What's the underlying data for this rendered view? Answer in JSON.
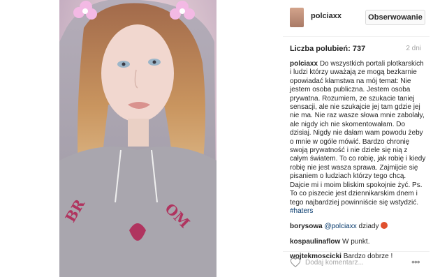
{
  "post": {
    "username": "polciaxx",
    "follow_label": "Obserwowanie",
    "likes_label": "Liczba polubień:",
    "likes_count": "737",
    "time_ago": "2 dni",
    "caption_user": "polciaxx",
    "caption_text": "Do wszystkich portali plotkarskich i ludzi którzy uważają ze mogą bezkarnie opowiadać kłamstwa na mój temat: Nie jestem osoba publiczna. Jestem osoba prywatna. Rozumiem, ze szukacie taniej sensacji, ale nie szukajcie jej tam gdzie jej nie ma. Nie raz wasze słowa mnie zabolały, ale nigdy ich nie skomentowałam. Do dzisiaj. Nigdy nie dałam wam powodu żeby o mnie w ogóle mówić. Bardzo chronię swoją prywatność i nie dziele się nią z całym światem. To co robię, jak robię i kiedy robię nie jest wasza sprawa. Zajmijcie się pisaniem o ludziach którzy tego chcą. Dajcie mi i moim bliskim spokojnie żyć. Ps. To co piszecie jest dziennikarskim dnem i tego najbardziej powinniście się wstydzić.",
    "caption_hashtag": "#haters"
  },
  "comments": [
    {
      "user": "borysowa",
      "mention": "@polciaxx",
      "text": "dziady",
      "emoji": "angry-face-emoji"
    },
    {
      "user": "kospaulinaflow",
      "text": "W punkt."
    },
    {
      "user": "wojtekmoscicki",
      "text": "Bardzo dobrze !"
    }
  ],
  "add_comment": {
    "placeholder": "Dodaj komentarz...",
    "like_icon": "heart-outline-icon",
    "more_icon": "more-options-icon"
  },
  "colors": {
    "link": "#003569",
    "muted": "#a6a6a6",
    "text": "#262626",
    "border": "#dbdbdb"
  }
}
